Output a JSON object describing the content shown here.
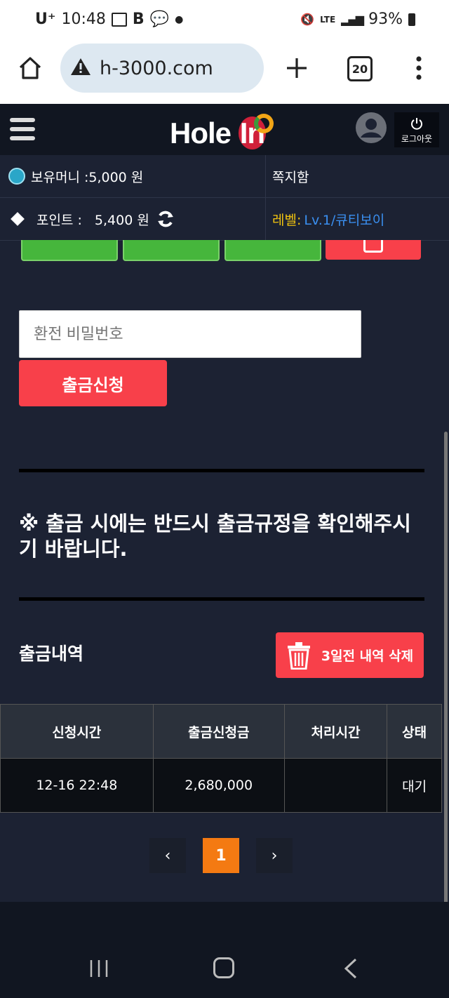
{
  "status_bar": {
    "carrier": "U⁺",
    "time": "10:48",
    "network": "LTE",
    "battery": "93%"
  },
  "browser": {
    "url": "h-3000.com",
    "tab_count": "20"
  },
  "header": {
    "logo_text": "Hole ",
    "logo_in": "In",
    "logout_label": "로그아웃"
  },
  "info": {
    "money_label": "보유머니 :5,000 원",
    "message_label": "쪽지함",
    "point_label": "포인트 :",
    "point_value": "5,400 원",
    "level_label": "레벨:",
    "level_value": "Lv.1/큐티보이"
  },
  "withdraw": {
    "password_placeholder": "환전 비밀번호",
    "submit_label": "출금신청",
    "notice": "※ 출금 시에는 반드시 출금규정을 확인해주시기 바랍니다."
  },
  "history": {
    "title": "출금내역",
    "delete_label": "3일전 내역 삭제",
    "columns": [
      "신청시간",
      "출금신청금",
      "처리시간",
      "상태"
    ],
    "rows": [
      {
        "time": "12-16 22:48",
        "amount": "2,680,000",
        "processed": "",
        "status": "대기"
      }
    ]
  },
  "pagination": {
    "prev": "‹",
    "current": "1",
    "next": "›"
  },
  "colors": {
    "accent_red": "#f8404a",
    "page_active": "#f47a12",
    "level_value": "#3a8ff0",
    "level_label": "#f2c40f"
  }
}
